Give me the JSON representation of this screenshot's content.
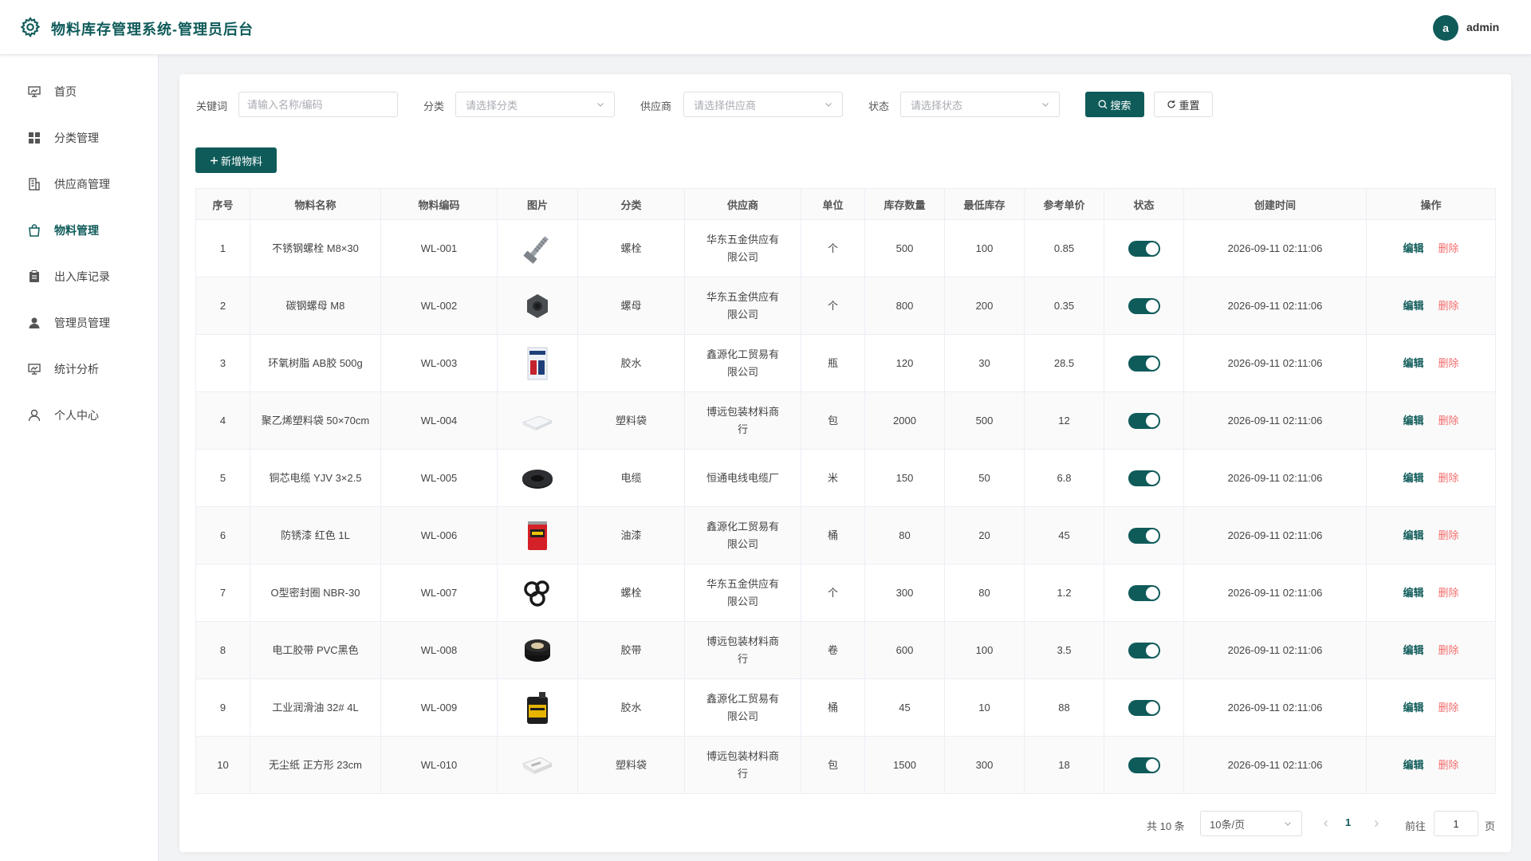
{
  "header": {
    "title": "物料库存管理系统-管理员后台",
    "avatar_letter": "a",
    "username": "admin"
  },
  "sidebar": {
    "items": [
      {
        "label": "首页",
        "icon": "monitor-chart-icon",
        "active": false
      },
      {
        "label": "分类管理",
        "icon": "grid-icon",
        "active": false
      },
      {
        "label": "供应商管理",
        "icon": "building-icon",
        "active": false
      },
      {
        "label": "物料管理",
        "icon": "shopping-bag-icon",
        "active": true
      },
      {
        "label": "出入库记录",
        "icon": "clipboard-icon",
        "active": false
      },
      {
        "label": "管理员管理",
        "icon": "user-filled-icon",
        "active": false
      },
      {
        "label": "统计分析",
        "icon": "monitor-chart-icon",
        "active": false
      },
      {
        "label": "个人中心",
        "icon": "user-outline-icon",
        "active": false
      }
    ]
  },
  "filters": {
    "keyword_label": "关键词",
    "keyword_placeholder": "请输入名称/编码",
    "keyword_value": "",
    "category_label": "分类",
    "category_placeholder": "请选择分类",
    "supplier_label": "供应商",
    "supplier_placeholder": "请选择供应商",
    "status_label": "状态",
    "status_placeholder": "请选择状态",
    "search_label": "搜索",
    "reset_label": "重置"
  },
  "actions": {
    "add_label": "新增物料"
  },
  "table": {
    "columns": [
      "序号",
      "物料名称",
      "物料编码",
      "图片",
      "分类",
      "供应商",
      "单位",
      "库存数量",
      "最低库存",
      "参考单价",
      "状态",
      "创建时间",
      "操作"
    ],
    "edit_label": "编辑",
    "delete_label": "删除",
    "rows": [
      {
        "no": "1",
        "name": "不锈钢螺栓 M8×30",
        "code": "WL-001",
        "image": "bolt",
        "category": "螺栓",
        "supplier": "华东五金供应有限公司",
        "unit": "个",
        "stock": "500",
        "min_stock": "100",
        "price": "0.85",
        "enabled": true,
        "created": "2026-09-11 02:11:06"
      },
      {
        "no": "2",
        "name": "碳钢螺母 M8",
        "code": "WL-002",
        "image": "nut",
        "category": "螺母",
        "supplier": "华东五金供应有限公司",
        "unit": "个",
        "stock": "800",
        "min_stock": "200",
        "price": "0.35",
        "enabled": true,
        "created": "2026-09-11 02:11:06"
      },
      {
        "no": "3",
        "name": "环氧树脂 AB胶 500g",
        "code": "WL-003",
        "image": "glue-box",
        "category": "胶水",
        "supplier": "鑫源化工贸易有限公司",
        "unit": "瓶",
        "stock": "120",
        "min_stock": "30",
        "price": "28.5",
        "enabled": true,
        "created": "2026-09-11 02:11:06"
      },
      {
        "no": "4",
        "name": "聚乙烯塑料袋 50×70cm",
        "code": "WL-004",
        "image": "plastic-bag",
        "category": "塑料袋",
        "supplier": "博远包装材料商行",
        "unit": "包",
        "stock": "2000",
        "min_stock": "500",
        "price": "12",
        "enabled": true,
        "created": "2026-09-11 02:11:06"
      },
      {
        "no": "5",
        "name": "铜芯电缆 YJV 3×2.5",
        "code": "WL-005",
        "image": "cable-coil",
        "category": "电缆",
        "supplier": "恒通电线电缆厂",
        "unit": "米",
        "stock": "150",
        "min_stock": "50",
        "price": "6.8",
        "enabled": true,
        "created": "2026-09-11 02:11:06"
      },
      {
        "no": "6",
        "name": "防锈漆 红色 1L",
        "code": "WL-006",
        "image": "paint-can",
        "category": "油漆",
        "supplier": "鑫源化工贸易有限公司",
        "unit": "桶",
        "stock": "80",
        "min_stock": "20",
        "price": "45",
        "enabled": true,
        "created": "2026-09-11 02:11:06"
      },
      {
        "no": "7",
        "name": "O型密封圈 NBR-30",
        "code": "WL-007",
        "image": "o-rings",
        "category": "螺栓",
        "supplier": "华东五金供应有限公司",
        "unit": "个",
        "stock": "300",
        "min_stock": "80",
        "price": "1.2",
        "enabled": true,
        "created": "2026-09-11 02:11:06"
      },
      {
        "no": "8",
        "name": "电工胶带 PVC黑色",
        "code": "WL-008",
        "image": "tape-roll",
        "category": "胶带",
        "supplier": "博远包装材料商行",
        "unit": "卷",
        "stock": "600",
        "min_stock": "100",
        "price": "3.5",
        "enabled": true,
        "created": "2026-09-11 02:11:06"
      },
      {
        "no": "9",
        "name": "工业润滑油 32# 4L",
        "code": "WL-009",
        "image": "oil-jug",
        "category": "胶水",
        "supplier": "鑫源化工贸易有限公司",
        "unit": "桶",
        "stock": "45",
        "min_stock": "10",
        "price": "88",
        "enabled": true,
        "created": "2026-09-11 02:11:06"
      },
      {
        "no": "10",
        "name": "无尘纸 正方形 23cm",
        "code": "WL-010",
        "image": "paper-pack",
        "category": "塑料袋",
        "supplier": "博远包装材料商行",
        "unit": "包",
        "stock": "1500",
        "min_stock": "300",
        "price": "18",
        "enabled": true,
        "created": "2026-09-11 02:11:06"
      }
    ]
  },
  "pagination": {
    "total_text": "共 10 条",
    "page_size": "10条/页",
    "current_page": "1",
    "goto_label": "前往",
    "goto_value": "1",
    "page_suffix": "页"
  },
  "colors": {
    "primary": "#0f5b5a",
    "danger": "#f56c6c"
  }
}
